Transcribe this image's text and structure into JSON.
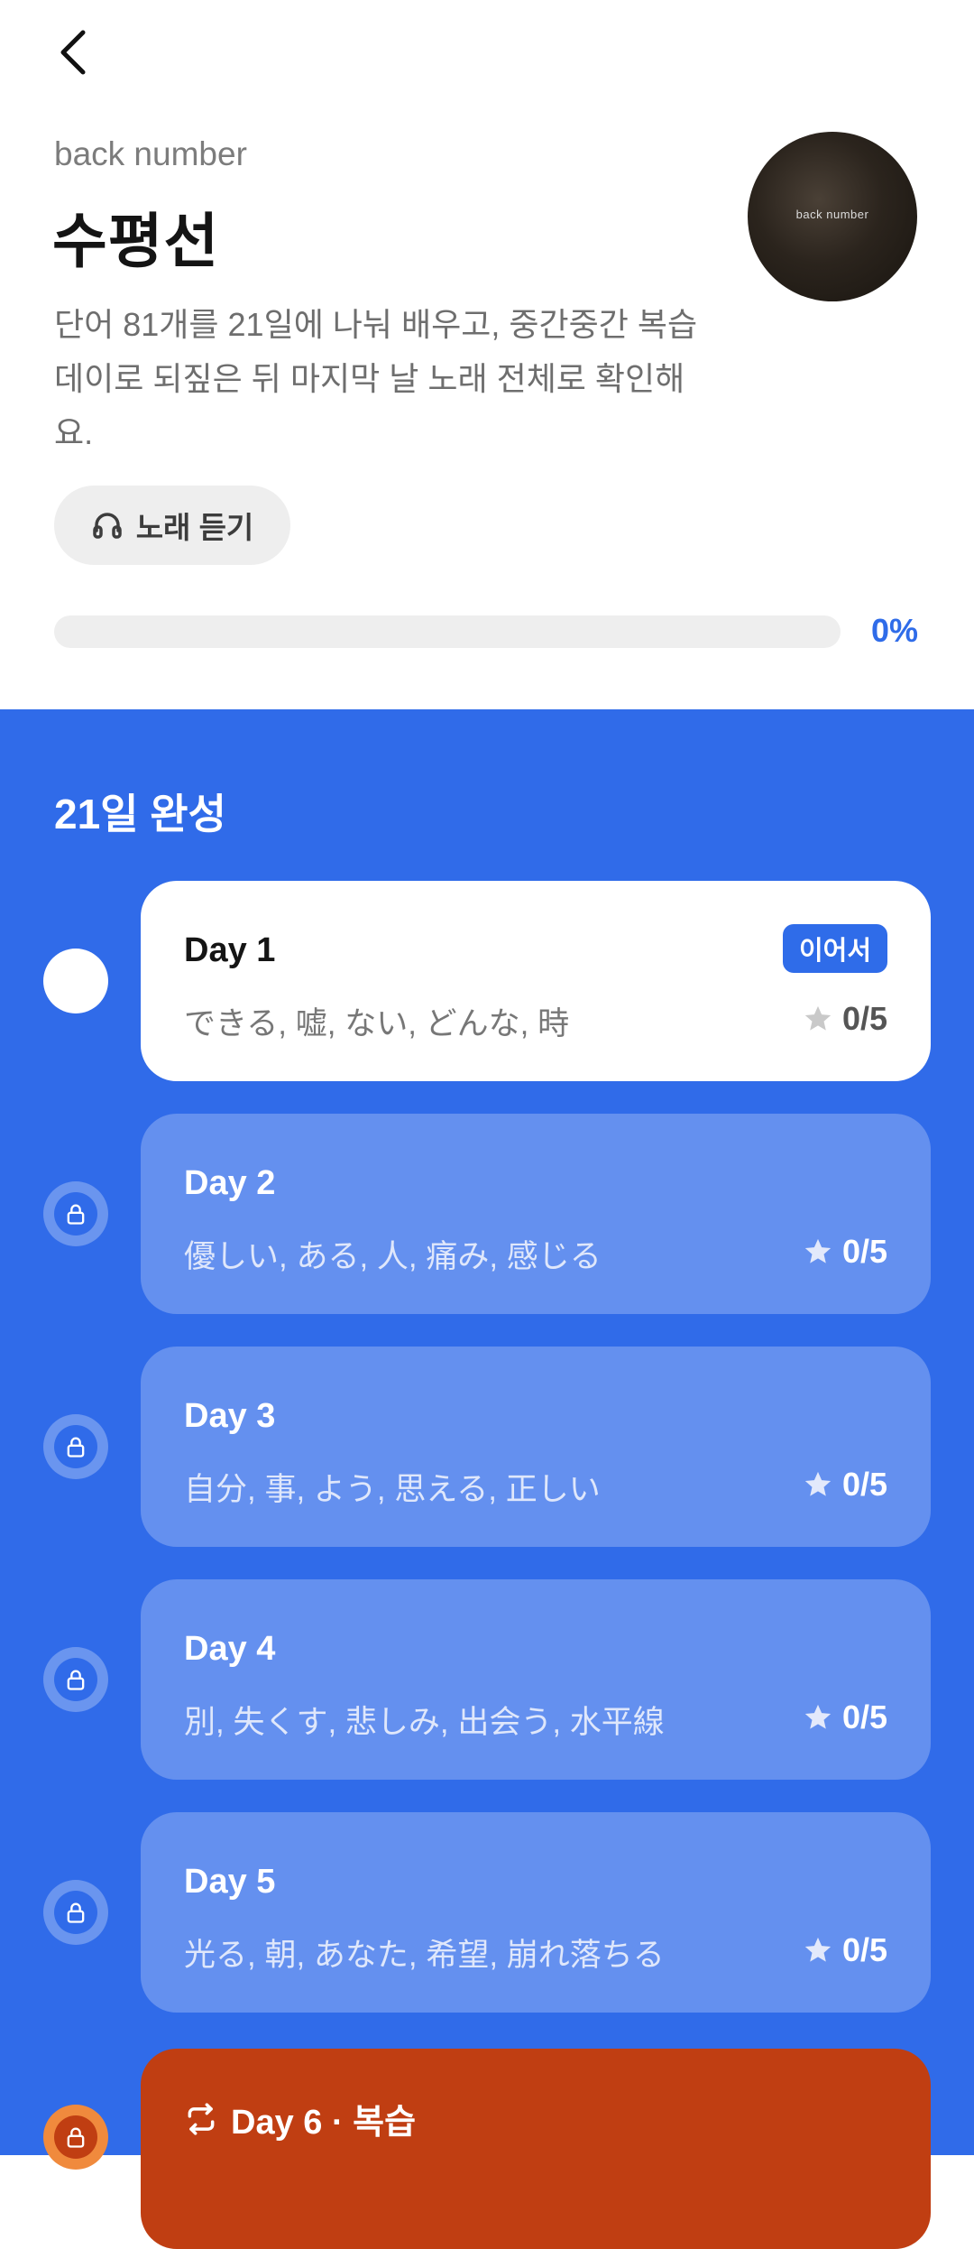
{
  "header": {
    "artist": "back number",
    "title": "수평선",
    "description": "단어 81개를 21일에 나눠 배우고, 중간중간 복습 데이로 되짚은 뒤 마지막 날 노래 전체로 확인해요.",
    "album_text": "back number",
    "listen_label": "노래 듣기",
    "progress_text": "0%",
    "progress_value": 0
  },
  "plan": {
    "title": "21일 완성",
    "days": [
      {
        "label": "Day 1",
        "words": "できる, 嘘, ない, どんな, 時",
        "score": "0/5",
        "badge": "이어서"
      },
      {
        "label": "Day 2",
        "words": "優しい, ある, 人, 痛み, 感じる",
        "score": "0/5"
      },
      {
        "label": "Day 3",
        "words": "自分, 事, よう, 思える, 正しい",
        "score": "0/5"
      },
      {
        "label": "Day 4",
        "words": "別, 失くす, 悲しみ, 出会う, 水平線",
        "score": "0/5"
      },
      {
        "label": "Day 5",
        "words": "光る, 朝, あなた, 希望, 崩れ落ちる",
        "score": "0/5"
      },
      {
        "label": "Day 6 · 복습"
      }
    ]
  },
  "colors": {
    "accent": "#306be9",
    "review": "#c03e12",
    "review_ring": "#f08a3d"
  },
  "icons": [
    "back-arrow-icon",
    "headphones-icon",
    "lock-icon",
    "star-icon",
    "repeat-icon"
  ]
}
